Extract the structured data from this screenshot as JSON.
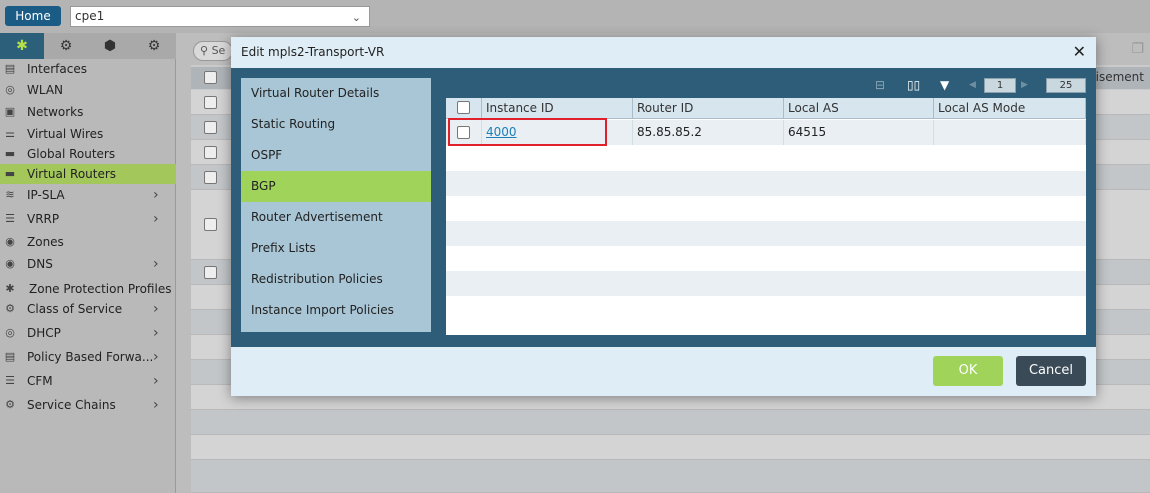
{
  "topbar": {
    "home_label": "Home",
    "device_value": "cpe1"
  },
  "sidebar": {
    "tab_icons": [
      "topology-icon",
      "gear-icon",
      "cube-icon",
      "global-settings-icon"
    ],
    "items": [
      {
        "label": "Interfaces",
        "icon": "interfaces-icon",
        "has_arrow": false
      },
      {
        "label": "WLAN",
        "icon": "wifi-icon",
        "has_arrow": false
      },
      {
        "label": "Networks",
        "icon": "network-icon",
        "has_arrow": false
      },
      {
        "label": "Virtual Wires",
        "icon": "wire-icon",
        "has_arrow": false
      },
      {
        "label": "Global Routers",
        "icon": "router-icon",
        "has_arrow": false
      },
      {
        "label": "Virtual Routers",
        "icon": "router-icon",
        "has_arrow": false,
        "active": true
      },
      {
        "label": "IP-SLA",
        "icon": "sla-icon",
        "has_arrow": true
      },
      {
        "label": "VRRP",
        "icon": "vrrp-icon",
        "has_arrow": true
      },
      {
        "label": "Zones",
        "icon": "zone-icon",
        "has_arrow": false
      },
      {
        "label": "DNS",
        "icon": "dns-icon",
        "has_arrow": true
      },
      {
        "label": "Zone Protection Profiles",
        "icon": "shield-icon",
        "has_arrow": false
      },
      {
        "label": "Class of Service",
        "icon": "cos-icon",
        "has_arrow": true
      },
      {
        "label": "DHCP",
        "icon": "dhcp-icon",
        "has_arrow": true
      },
      {
        "label": "Policy Based Forwa...",
        "icon": "policy-icon",
        "has_arrow": true
      },
      {
        "label": "CFM",
        "icon": "cfm-icon",
        "has_arrow": true
      },
      {
        "label": "Service Chains",
        "icon": "gear-icon",
        "has_arrow": true
      }
    ]
  },
  "main": {
    "search_placeholder": "Se",
    "header_text": "tisement"
  },
  "modal": {
    "title": "Edit mpls2-Transport-VR",
    "nav": [
      {
        "label": "Virtual Router Details"
      },
      {
        "label": "Static Routing"
      },
      {
        "label": "OSPF"
      },
      {
        "label": "BGP",
        "active": true
      },
      {
        "label": "Router Advertisement"
      },
      {
        "label": "Prefix Lists"
      },
      {
        "label": "Redistribution Policies"
      },
      {
        "label": "Instance Import Policies"
      }
    ],
    "toolbar": {
      "page_value": "1",
      "page_size": "25"
    },
    "table": {
      "columns": [
        "Instance ID",
        "Router ID",
        "Local AS",
        "Local AS Mode"
      ],
      "rows": [
        {
          "instance_id": "4000",
          "router_id": "85.85.85.2",
          "local_as": "64515",
          "local_as_mode": ""
        }
      ]
    },
    "ok_label": "OK",
    "cancel_label": "Cancel"
  },
  "colors": {
    "accent_green": "#9fd35a",
    "modal_dark": "#2e5d79",
    "home_blue": "#1b5c86",
    "highlight_red": "#e0202a"
  }
}
